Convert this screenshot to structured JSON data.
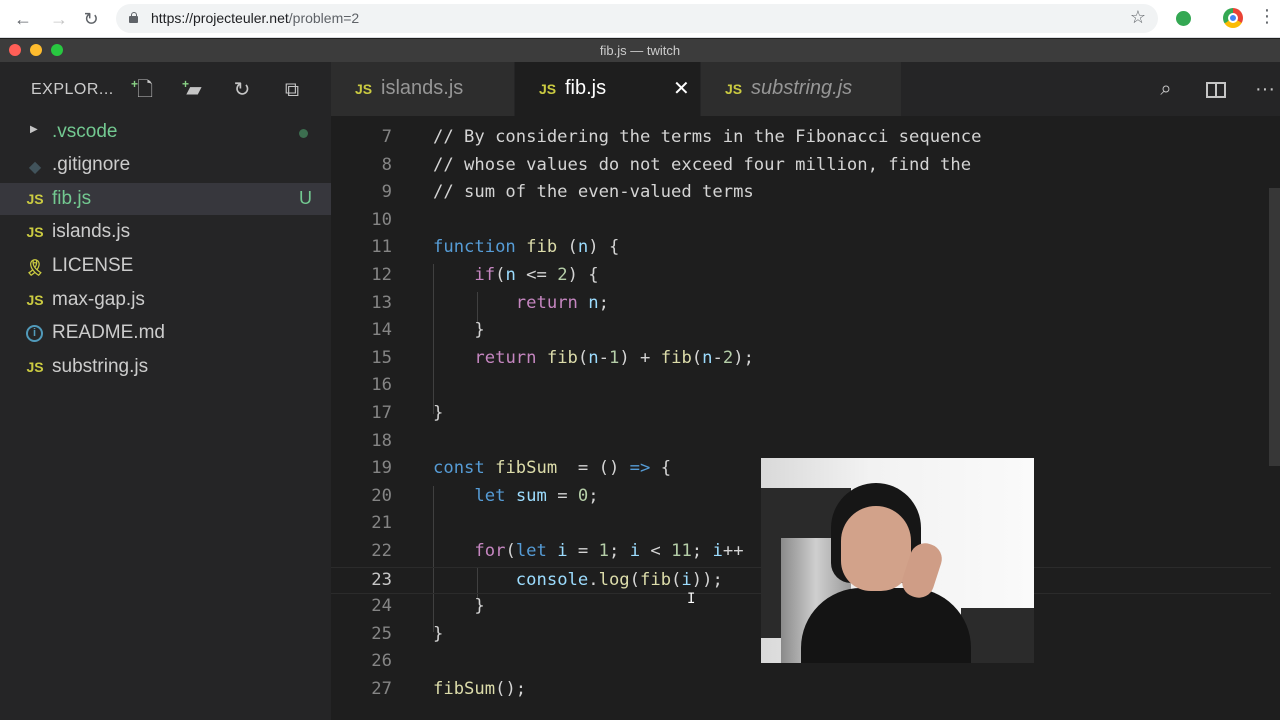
{
  "browser": {
    "url_host": "https://projecteuler.net",
    "url_path": "/problem=2",
    "icons": [
      "back-arrow-icon",
      "forward-arrow-icon",
      "reload-icon",
      "lock-icon",
      "star-icon",
      "kebab-menu-icon"
    ]
  },
  "window": {
    "title": "fib.js — twitch"
  },
  "sidebar": {
    "header": "EXPLOR...",
    "items": [
      {
        "label": ".vscode",
        "type": "folder",
        "decoration": "dot"
      },
      {
        "label": ".gitignore",
        "type": "git"
      },
      {
        "label": "fib.js",
        "type": "js",
        "badge": "U",
        "selected": true
      },
      {
        "label": "islands.js",
        "type": "js"
      },
      {
        "label": "LICENSE",
        "type": "license"
      },
      {
        "label": "max-gap.js",
        "type": "js"
      },
      {
        "label": "README.md",
        "type": "info"
      },
      {
        "label": "substring.js",
        "type": "js"
      }
    ]
  },
  "tabs": [
    {
      "label": "islands.js",
      "icon": "JS"
    },
    {
      "label": "fib.js",
      "icon": "JS",
      "active": true,
      "close": "✕"
    },
    {
      "label": "substring.js",
      "icon": "JS",
      "preview": true
    }
  ],
  "editor": {
    "lines": [
      {
        "n": "7",
        "code": "// By considering the terms in the Fibonacci sequence"
      },
      {
        "n": "8",
        "code": "// whose values do not exceed four million, find the"
      },
      {
        "n": "9",
        "code": "// sum of the even-valued terms"
      },
      {
        "n": "10",
        "code": ""
      },
      {
        "n": "11",
        "code": "function fib (n) {"
      },
      {
        "n": "12",
        "code": "    if(n <= 2) {"
      },
      {
        "n": "13",
        "code": "        return n;"
      },
      {
        "n": "14",
        "code": "    }"
      },
      {
        "n": "15",
        "code": "    return fib(n-1) + fib(n-2);"
      },
      {
        "n": "16",
        "code": ""
      },
      {
        "n": "17",
        "code": "}"
      },
      {
        "n": "18",
        "code": ""
      },
      {
        "n": "19",
        "code": "const fibSum  = () => {"
      },
      {
        "n": "20",
        "code": "    let sum = 0;"
      },
      {
        "n": "21",
        "code": ""
      },
      {
        "n": "22",
        "code": "    for(let i = 1; i < 11; i++"
      },
      {
        "n": "23",
        "code": "        console.log(fib(i));"
      },
      {
        "n": "24",
        "code": "    }"
      },
      {
        "n": "25",
        "code": "}"
      },
      {
        "n": "26",
        "code": ""
      },
      {
        "n": "27",
        "code": "fibSum();"
      }
    ],
    "current_line": "23"
  }
}
